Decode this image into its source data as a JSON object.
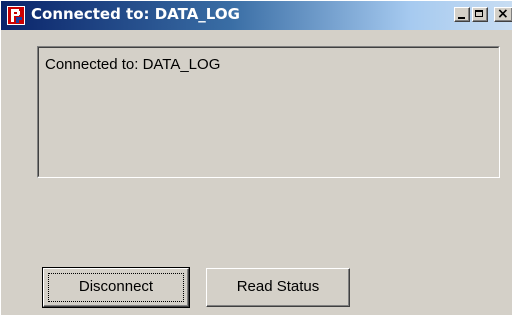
{
  "window": {
    "title": "Connected to: DATA_LOG",
    "icon": "app-logo-icon",
    "caption_buttons": {
      "minimize_icon": "minimize-icon",
      "maximize_icon": "maximize-icon",
      "close_icon": "close-icon",
      "close_glyph": "×"
    }
  },
  "status": {
    "text": "Connected to: DATA_LOG"
  },
  "buttons": {
    "disconnect_label": "Disconnect",
    "read_status_label": "Read Status"
  },
  "colors": {
    "titlebar_start": "#0a246a",
    "titlebar_end": "#c8ddf2",
    "face": "#d4d0c8",
    "icon_red": "#cc0000",
    "icon_blue": "#1e3fa0"
  }
}
